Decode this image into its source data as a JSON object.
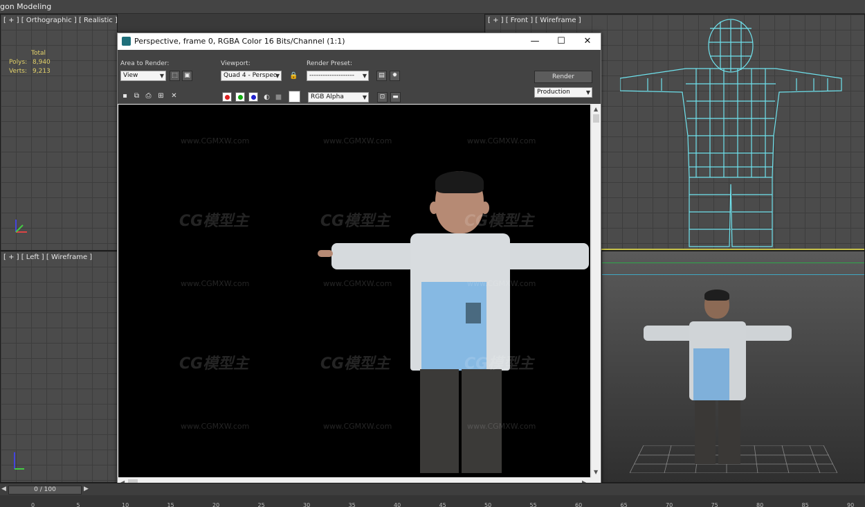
{
  "menubar": {
    "title": "gon Modeling"
  },
  "viewports": {
    "top_left": {
      "label": "[ + ] [ Orthographic ] [ Realistic ]",
      "stats": {
        "total_label": "Total",
        "polys_label": "Polys:",
        "polys_value": "8,940",
        "verts_label": "Verts:",
        "verts_value": "9,213"
      }
    },
    "top_right": {
      "label": "[ + ] [ Front ] [ Wireframe ]"
    },
    "bottom_left": {
      "label": "[ + ] [ Left ] [ Wireframe ]"
    },
    "bottom_right": {
      "label": ""
    }
  },
  "render_window": {
    "title": "Perspective, frame 0, RGBA Color 16 Bits/Channel (1:1)",
    "minimize": "—",
    "maximize": "☐",
    "close": "✕",
    "area_to_render_label": "Area to Render:",
    "area_to_render_value": "View",
    "viewport_label": "Viewport:",
    "viewport_value": "Quad 4 - Perspec",
    "render_preset_label": "Render Preset:",
    "render_preset_value": "--------------------",
    "render_button": "Render",
    "production_value": "Production",
    "channel_value": "RGB Alpha"
  },
  "watermarks": {
    "url": "www.CGMXW.com",
    "logo": "CG模型主"
  },
  "timeline": {
    "frame_display": "0 / 100",
    "ticks": [
      "0",
      "5",
      "10",
      "15",
      "20",
      "25",
      "30",
      "35",
      "40",
      "45",
      "50",
      "55",
      "60",
      "65",
      "70",
      "75",
      "80",
      "85",
      "90"
    ]
  },
  "colors": {
    "viewport_bg": "#4b4b4b",
    "wireframe": "#6fe3ee",
    "stats_text": "#e3d26a",
    "render_bg": "#000000",
    "window_chrome": "#f0f0f0"
  }
}
